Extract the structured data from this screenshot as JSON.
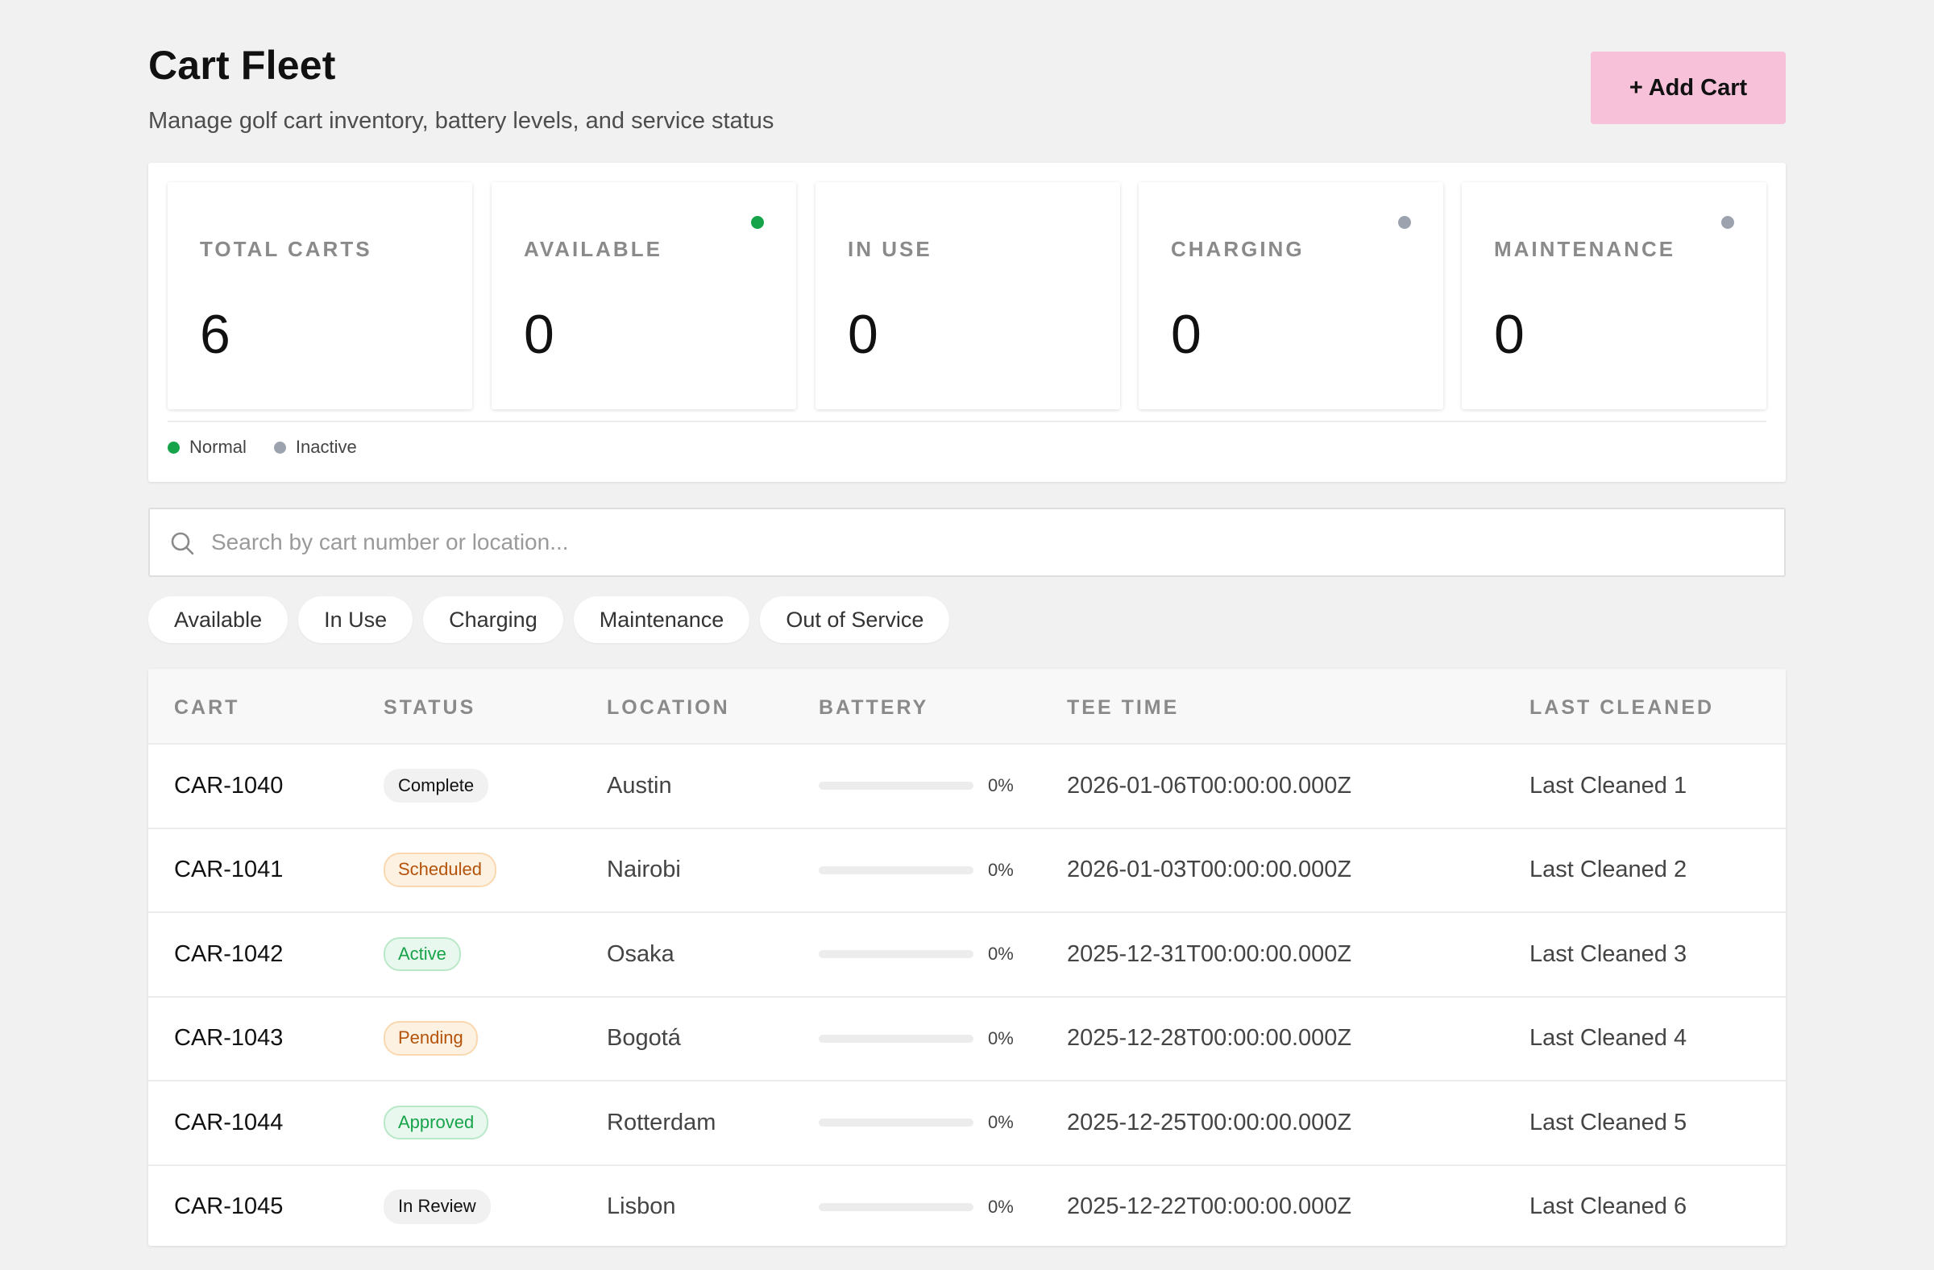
{
  "header": {
    "title": "Cart Fleet",
    "subtitle": "Manage golf cart inventory, battery levels, and service status",
    "add_button": "+ Add Cart"
  },
  "stats": [
    {
      "label": "TOTAL CARTS",
      "value": "6",
      "dot": null
    },
    {
      "label": "AVAILABLE",
      "value": "0",
      "dot": "#16a34a"
    },
    {
      "label": "IN USE",
      "value": "0",
      "dot": null
    },
    {
      "label": "CHARGING",
      "value": "0",
      "dot": "#9ca3af"
    },
    {
      "label": "MAINTENANCE",
      "value": "0",
      "dot": "#9ca3af"
    }
  ],
  "legend": [
    {
      "label": "Normal",
      "color": "#16a34a"
    },
    {
      "label": "Inactive",
      "color": "#9ca3af"
    }
  ],
  "search": {
    "placeholder": "Search by cart number or location...",
    "value": ""
  },
  "filters": [
    "Available",
    "In Use",
    "Charging",
    "Maintenance",
    "Out of Service"
  ],
  "table": {
    "columns": [
      "CART",
      "STATUS",
      "LOCATION",
      "BATTERY",
      "TEE TIME",
      "LAST CLEANED"
    ],
    "rows": [
      {
        "cart": "CAR-1040",
        "status": "Complete",
        "status_kind": "neutral",
        "location": "Austin",
        "battery": 0,
        "battery_label": "0%",
        "tee_time": "2026-01-06T00:00:00.000Z",
        "last_cleaned": "Last Cleaned 1"
      },
      {
        "cart": "CAR-1041",
        "status": "Scheduled",
        "status_kind": "warn",
        "location": "Nairobi",
        "battery": 0,
        "battery_label": "0%",
        "tee_time": "2026-01-03T00:00:00.000Z",
        "last_cleaned": "Last Cleaned 2"
      },
      {
        "cart": "CAR-1042",
        "status": "Active",
        "status_kind": "ok",
        "location": "Osaka",
        "battery": 0,
        "battery_label": "0%",
        "tee_time": "2025-12-31T00:00:00.000Z",
        "last_cleaned": "Last Cleaned 3"
      },
      {
        "cart": "CAR-1043",
        "status": "Pending",
        "status_kind": "warn",
        "location": "Bogotá",
        "battery": 0,
        "battery_label": "0%",
        "tee_time": "2025-12-28T00:00:00.000Z",
        "last_cleaned": "Last Cleaned 4"
      },
      {
        "cart": "CAR-1044",
        "status": "Approved",
        "status_kind": "ok",
        "location": "Rotterdam",
        "battery": 0,
        "battery_label": "0%",
        "tee_time": "2025-12-25T00:00:00.000Z",
        "last_cleaned": "Last Cleaned 5"
      },
      {
        "cart": "CAR-1045",
        "status": "In Review",
        "status_kind": "neutral",
        "location": "Lisbon",
        "battery": 0,
        "battery_label": "0%",
        "tee_time": "2025-12-22T00:00:00.000Z",
        "last_cleaned": "Last Cleaned 6"
      }
    ]
  }
}
